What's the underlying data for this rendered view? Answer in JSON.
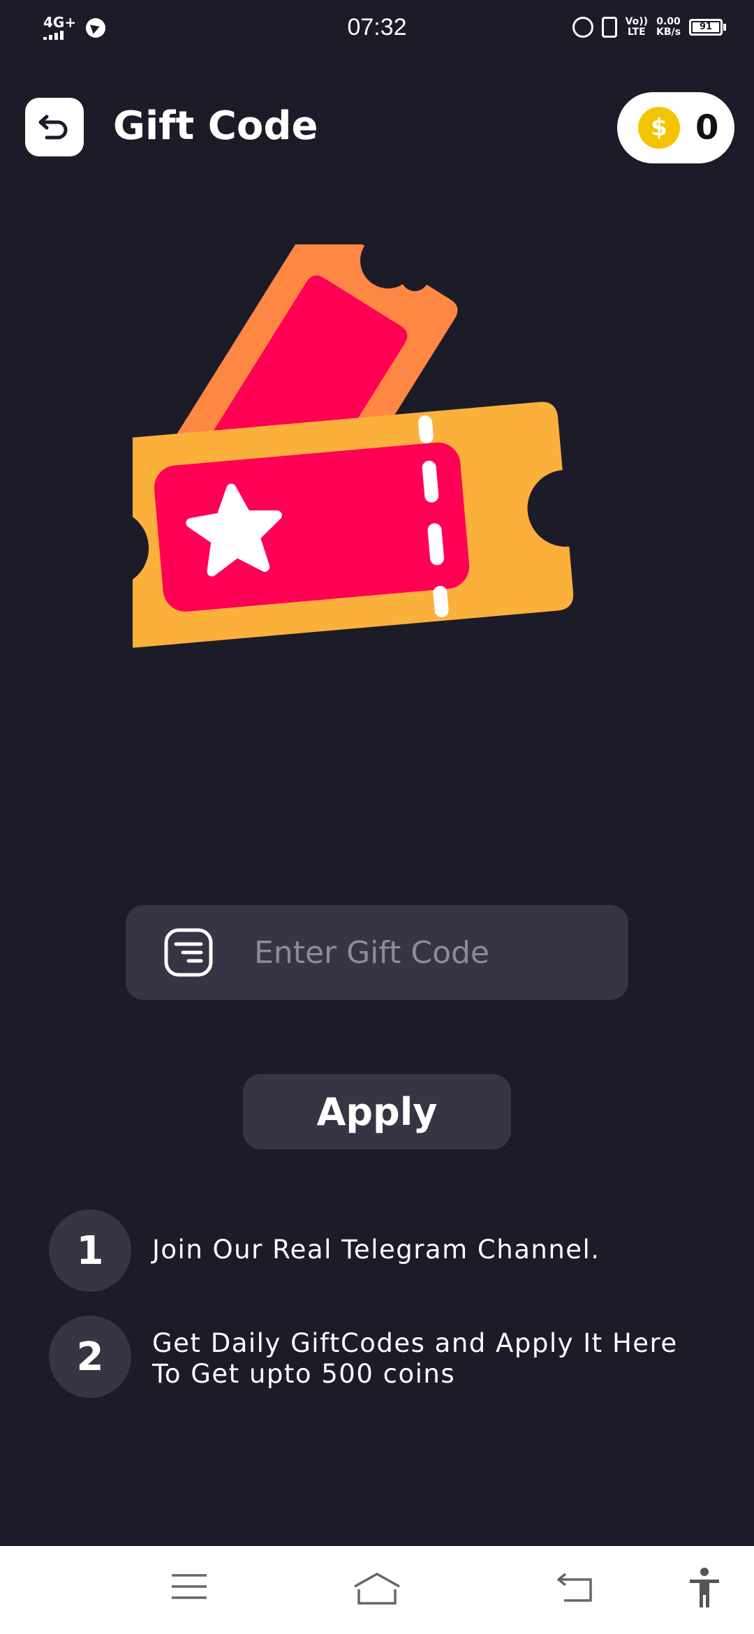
{
  "status_bar": {
    "network": "4G+",
    "time": "07:32",
    "volte_top": "Vo))",
    "volte_bottom": "LTE",
    "speed_value": "0.00",
    "speed_unit": "KB/s",
    "battery": "91"
  },
  "header": {
    "title": "Gift Code",
    "coins": "0",
    "coin_symbol": "$"
  },
  "form": {
    "placeholder": "Enter Gift Code",
    "value": "",
    "apply_label": "Apply"
  },
  "steps": [
    {
      "number": "1",
      "text": "Join Our Real Telegram Channel."
    },
    {
      "number": "2",
      "text": "Get Daily GiftCodes and Apply It Here To Get upto 500 coins"
    }
  ],
  "colors": {
    "background": "#1c1c28",
    "surface": "#353543",
    "ticket_orange": "#fbb03b",
    "ticket_back": "#ff8744",
    "ticket_pink": "#ff0055",
    "coin": "#f5c400"
  },
  "icons": {
    "back": "back-arrow-icon",
    "coin": "dollar-coin-icon",
    "code": "gift-code-icon",
    "nav": [
      "menu-icon",
      "home-icon",
      "back-icon",
      "accessibility-icon"
    ]
  }
}
